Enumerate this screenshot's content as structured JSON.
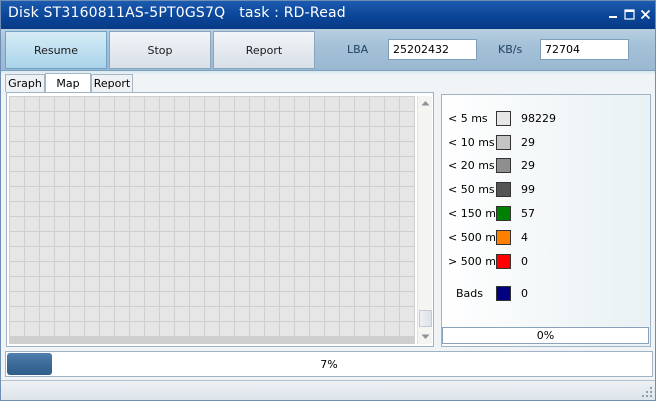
{
  "window": {
    "title": "Disk ST3160811AS-5PT0GS7Q   task : RD-Read"
  },
  "toolbar": {
    "resume_label": "Resume",
    "stop_label": "Stop",
    "report_label": "Report",
    "lba_label": "LBA",
    "lba_value": "25202432",
    "kbs_label": "KB/s",
    "kbs_value": "72704"
  },
  "tabs": [
    {
      "label": "Graph",
      "selected": false
    },
    {
      "label": "Map",
      "selected": true
    },
    {
      "label": "Report",
      "selected": false
    }
  ],
  "map": {
    "block_color": "#e6e6e6",
    "gap_color": "#cfcfcf"
  },
  "legend": {
    "items": [
      {
        "label": "< 5 ms",
        "color": "#e6e6e6",
        "value": "98229"
      },
      {
        "label": "< 10 ms",
        "color": "#c4c4c4",
        "value": "29"
      },
      {
        "label": "< 20 ms",
        "color": "#8f8f8f",
        "value": "29"
      },
      {
        "label": "< 50 ms",
        "color": "#555555",
        "value": "99"
      },
      {
        "label": "< 150 ms",
        "color": "#008000",
        "value": "57"
      },
      {
        "label": "< 500 ms",
        "color": "#ff8000",
        "value": "4"
      },
      {
        "label": "> 500 ms",
        "color": "#ff0000",
        "value": "0"
      },
      {
        "label": "Bads",
        "color": "#000080",
        "value": "0"
      }
    ],
    "progress_text": "0%"
  },
  "progress": {
    "text": "7%",
    "fraction": 0.07
  }
}
